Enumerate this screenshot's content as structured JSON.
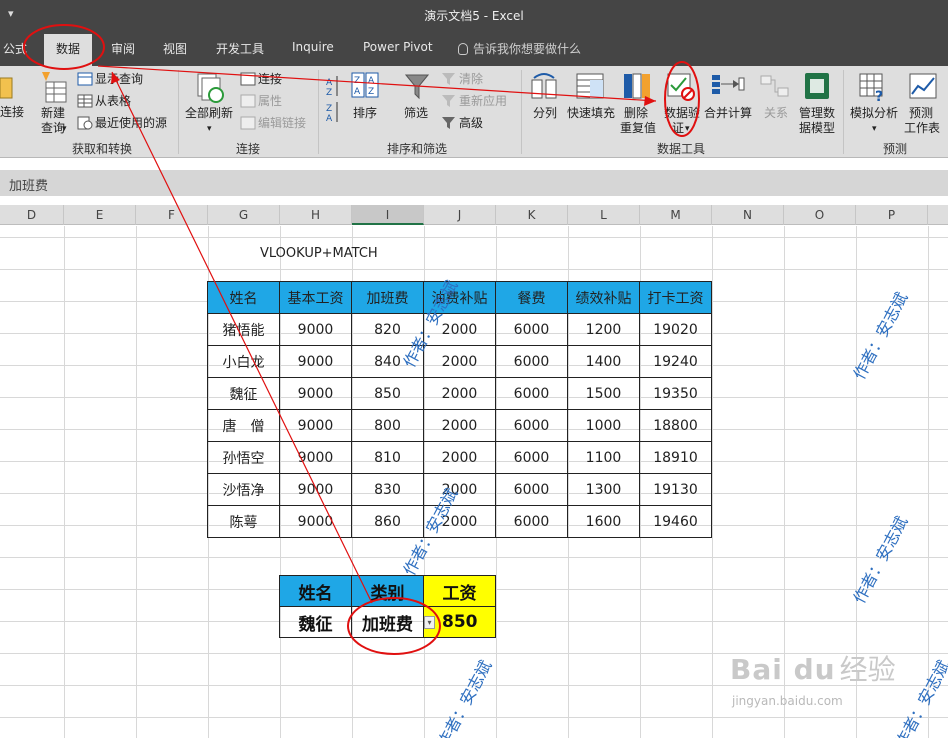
{
  "app": {
    "window_title": "演示文档5  -  Excel",
    "qat_arrow": "▾"
  },
  "tabs": [
    "公式",
    "数据",
    "审阅",
    "视图",
    "开发工具",
    "Inquire",
    "Power Pivot"
  ],
  "tell_me": "告诉我你想要做什么",
  "ribbon": {
    "get_transform": {
      "connect_partial": "连接",
      "new_query": "新建\n查询",
      "show_queries": "显示查询",
      "from_table": "从表格",
      "recent_sources": "最近使用的源",
      "group_label": "获取和转换"
    },
    "connections": {
      "refresh_all": "全部刷新",
      "connections": "连接",
      "properties": "属性",
      "edit_links": "编辑链接",
      "group_label": "连接"
    },
    "sort_filter": {
      "sort": "排序",
      "filter": "筛选",
      "clear": "清除",
      "reapply": "重新应用",
      "advanced": "高级",
      "group_label": "排序和筛选"
    },
    "data_tools": {
      "text_to_columns": "分列",
      "flash_fill": "快速填充",
      "remove_duplicates_1": "删除",
      "remove_duplicates_2": "重复值",
      "data_validation_1": "数据验",
      "data_validation_2": "证",
      "consolidate": "合并计算",
      "relationships": "关系",
      "manage_model_1": "管理数",
      "manage_model_2": "据模型",
      "group_label": "数据工具"
    },
    "forecast": {
      "what_if": "模拟分析",
      "forecast_sheet_1": "预测",
      "forecast_sheet_2": "工作表",
      "group_label": "预测"
    }
  },
  "name_bar": "加班费",
  "columns": [
    {
      "label": "D",
      "selected": false
    },
    {
      "label": "E",
      "selected": false
    },
    {
      "label": "F",
      "selected": false
    },
    {
      "label": "G",
      "selected": false
    },
    {
      "label": "H",
      "selected": false
    },
    {
      "label": "I",
      "selected": true
    },
    {
      "label": "J",
      "selected": false
    },
    {
      "label": "K",
      "selected": false
    },
    {
      "label": "L",
      "selected": false
    },
    {
      "label": "M",
      "selected": false
    },
    {
      "label": "N",
      "selected": false
    },
    {
      "label": "O",
      "selected": false
    },
    {
      "label": "P",
      "selected": false
    }
  ],
  "formula_note": "VLOOKUP+MATCH",
  "main_table": {
    "headers": [
      "姓名",
      "基本工资",
      "加班费",
      "油费补贴",
      "餐费",
      "绩效补贴",
      "打卡工资"
    ],
    "rows": [
      [
        "猪悟能",
        "9000",
        "820",
        "2000",
        "6000",
        "1200",
        "19020"
      ],
      [
        "小白龙",
        "9000",
        "840",
        "2000",
        "6000",
        "1400",
        "19240"
      ],
      [
        "魏征",
        "9000",
        "850",
        "2000",
        "6000",
        "1500",
        "19350"
      ],
      [
        "唐　僧",
        "9000",
        "800",
        "2000",
        "6000",
        "1000",
        "18800"
      ],
      [
        "孙悟空",
        "9000",
        "810",
        "2000",
        "6000",
        "1100",
        "18910"
      ],
      [
        "沙悟净",
        "9000",
        "830",
        "2000",
        "6000",
        "1300",
        "19130"
      ],
      [
        "陈萼",
        "9000",
        "860",
        "2000",
        "6000",
        "1600",
        "19460"
      ]
    ]
  },
  "lookup": {
    "headers": [
      "姓名",
      "类别",
      "工资"
    ],
    "name": "魏征",
    "category": "加班费",
    "result": "850"
  },
  "watermark_text": "作者：安志斌",
  "baidu": {
    "logo": "Bai  du",
    "logo_cn": "经验",
    "url": "jingyan.baidu.com"
  },
  "colors": {
    "title_bar": "#454545",
    "ribbon_bg": "#dedede",
    "header_blue": "#1fa7e6",
    "lookup_yellow": "#ffff00",
    "annotation_red": "#e01010",
    "excel_green": "#217346",
    "watermark_blue": "#2e6fc0"
  }
}
